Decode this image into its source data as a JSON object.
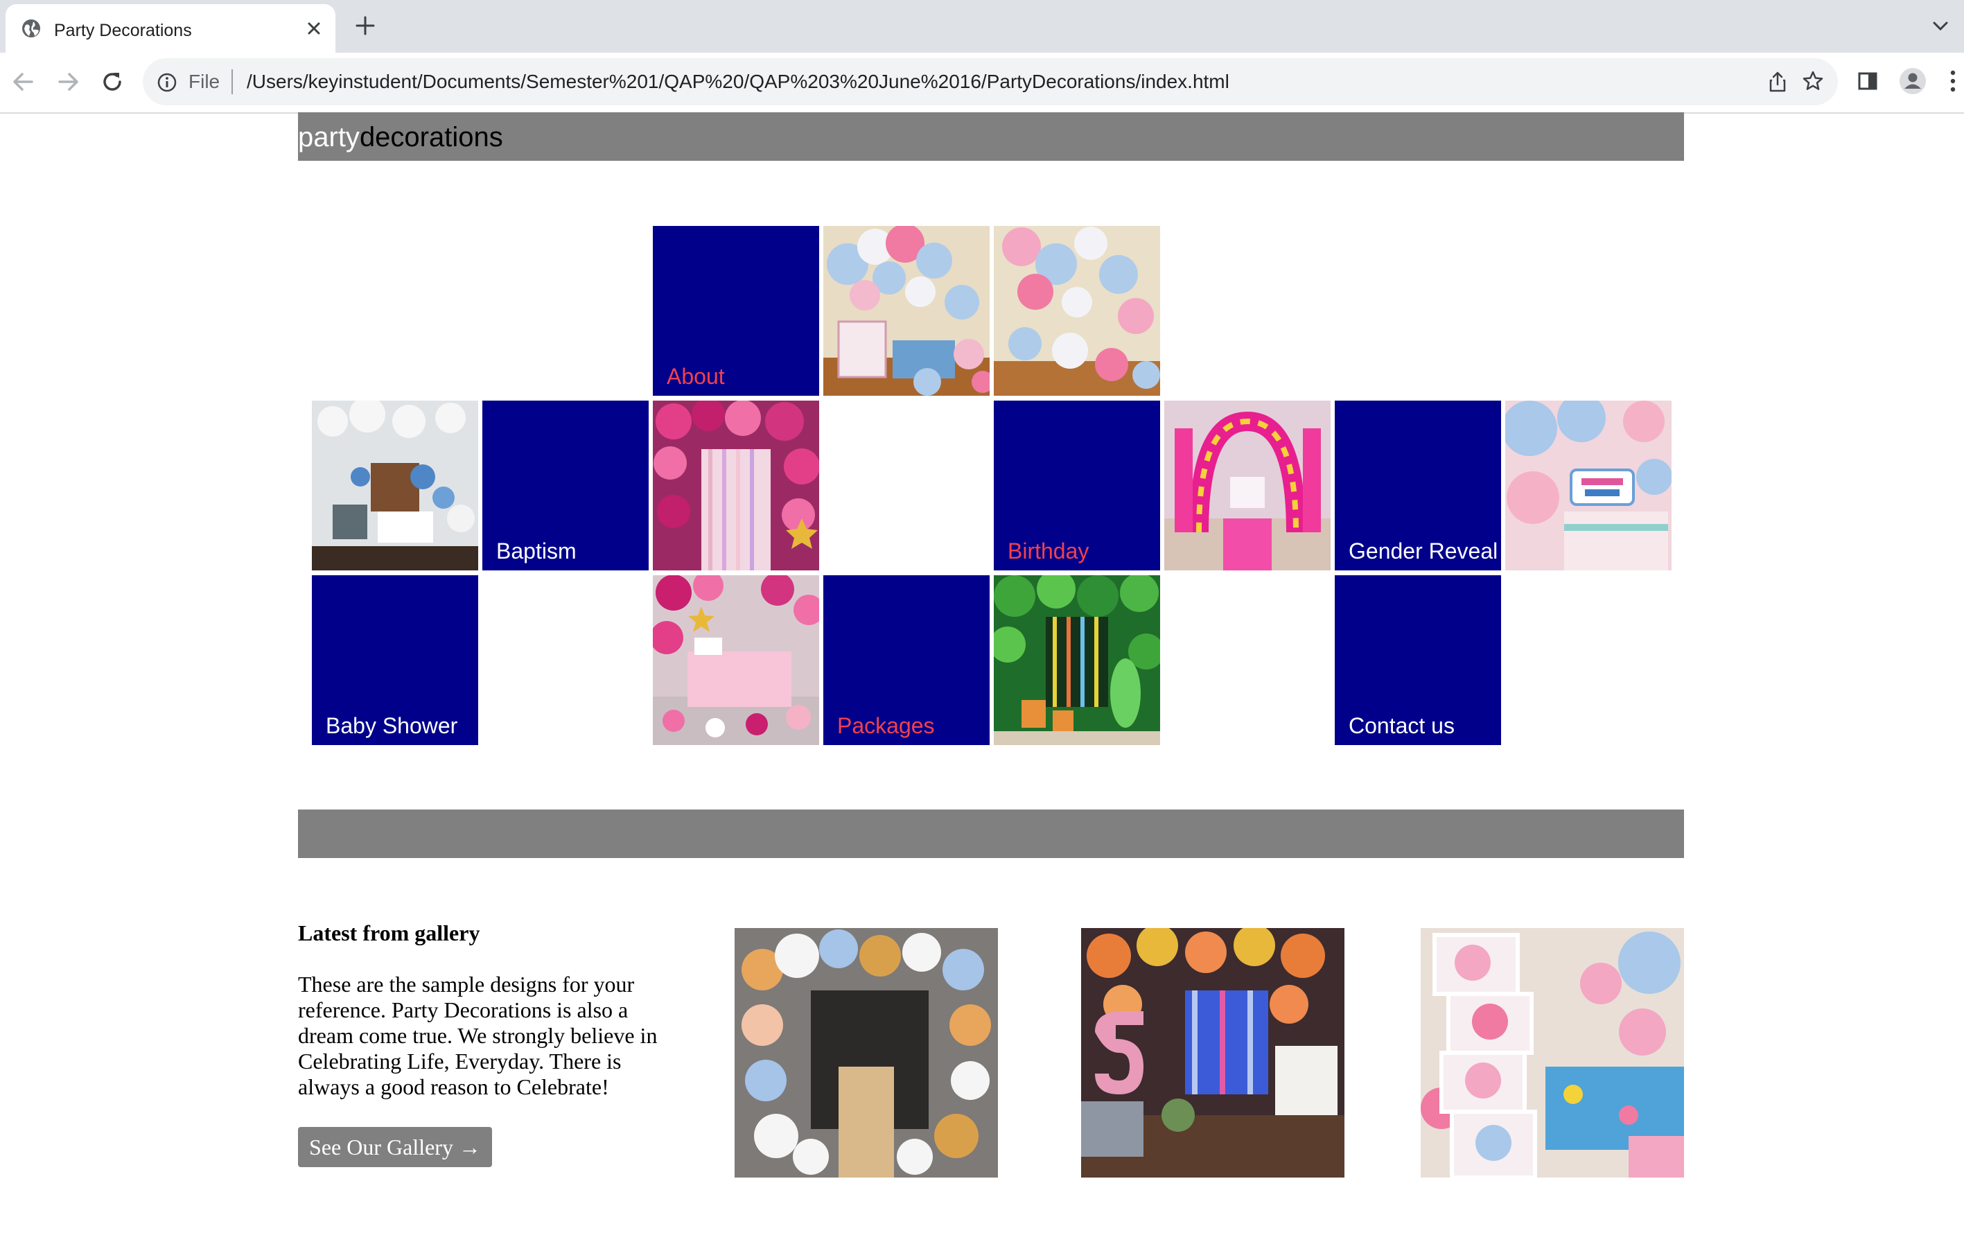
{
  "browser": {
    "tab_title": "Party Decorations",
    "omnibox_scheme_label": "File",
    "url": "/Users/keyinstudent/Documents/Semester%201/QAP%20/QAP%203%20June%2016/PartyDecorations/index.html"
  },
  "site": {
    "logo_part1": "party",
    "logo_part2": "decorations"
  },
  "tiles": {
    "about": "About",
    "baptism": "Baptism",
    "birthday": "Birthday",
    "gender_reveal": "Gender Reveal",
    "baby_shower": "Baby Shower",
    "packages": "Packages",
    "contact": "Contact us"
  },
  "gallery": {
    "heading": "Latest from gallery",
    "body": "These are the sample designs for your reference. Party Decorations is also a dream come true. We strongly believe in Celebrating Life, Everyday. There is always a good reason to Celebrate!",
    "button_label": "See Our Gallery →"
  },
  "colors": {
    "header_gray": "#808080",
    "tile_blue": "#00008b",
    "tile_label_red": "#f2414b",
    "tile_label_white": "#ffffff"
  },
  "icons": [
    "globe-icon",
    "close-icon",
    "plus-icon",
    "chevron-down-icon",
    "back-arrow-icon",
    "forward-arrow-icon",
    "reload-icon",
    "info-icon",
    "share-icon",
    "star-icon",
    "side-panel-icon",
    "profile-icon",
    "kebab-menu-icon"
  ]
}
